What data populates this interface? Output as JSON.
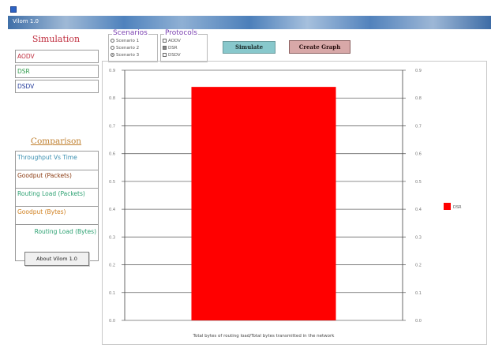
{
  "window": {
    "title": "Vilom 1.0"
  },
  "left_panel": {
    "simulation_title": "Simulation",
    "simulation_buttons": [
      "AODV",
      "DSR",
      "DSDV"
    ],
    "comparison_title": "Comparison",
    "comparison_items": [
      "Throughput Vs Time",
      "Goodput (Packets)",
      "Routing Load (Packets)",
      "Goodput (Bytes)",
      "Routing Load (Bytes)"
    ],
    "about_button": "About Vilom 1.0"
  },
  "scenarios": {
    "label": "Scenarios",
    "options": [
      "Scenario 1",
      "Scenario 2",
      "Scenario 3"
    ],
    "selected": "Scenario 3"
  },
  "protocols": {
    "label": "Protocols",
    "options": [
      "AODV",
      "DSR",
      "DSDV"
    ],
    "checked": [
      "DSR"
    ]
  },
  "toolbar": {
    "simulate_label": "Simulate",
    "create_graph_label": "Create Graph"
  },
  "colors": {
    "bar": "#ff0000",
    "simulate_button": "#88c8cc",
    "create_graph_button": "#d8a8a8"
  },
  "chart_data": {
    "type": "bar",
    "categories": [
      "DSR"
    ],
    "series": [
      {
        "name": "DSR",
        "values": [
          0.84
        ]
      }
    ],
    "ylim": [
      0.0,
      0.9
    ],
    "yticks": [
      "0.0",
      "0.1",
      "0.2",
      "0.3",
      "0.4",
      "0.5",
      "0.6",
      "0.7",
      "0.8",
      "0.9"
    ],
    "xlabel": "Total bytes of routing load/Total bytes transmitted in the network",
    "ylabel": "",
    "grid": true,
    "legend": "right",
    "dual_y_axis": true
  }
}
